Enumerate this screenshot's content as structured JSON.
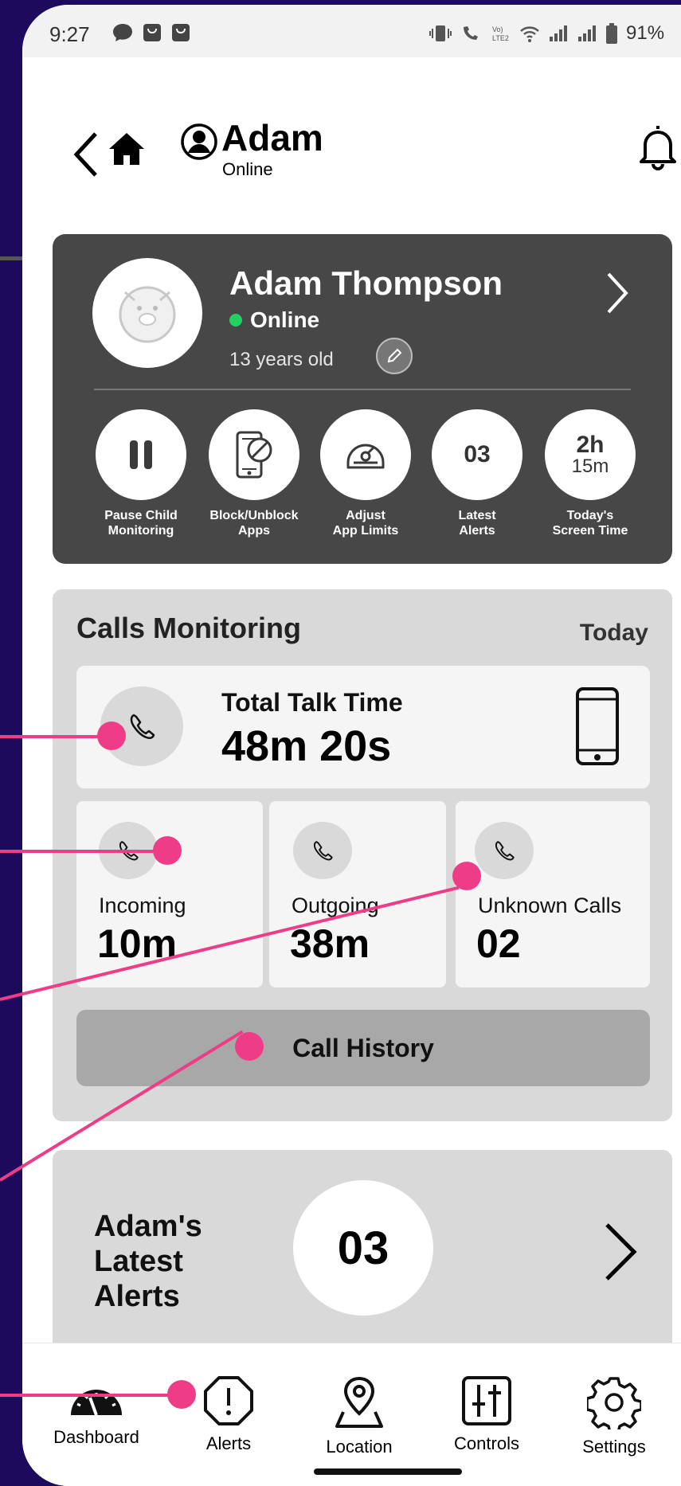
{
  "status_bar": {
    "time": "9:27",
    "battery": "91%"
  },
  "header": {
    "name": "Adam",
    "status": "Online"
  },
  "profile": {
    "full_name": "Adam Thompson",
    "status": "Online",
    "age": "13 years old"
  },
  "quick_actions": [
    {
      "label_line1": "Pause Child",
      "label_line2": "Monitoring"
    },
    {
      "label_line1": "Block/Unblock",
      "label_line2": "Apps"
    },
    {
      "label_line1": "Adjust",
      "label_line2": "App Limits"
    },
    {
      "label_line1": "Latest",
      "label_line2": "Alerts",
      "value": "03"
    },
    {
      "label_line1": "Today's",
      "label_line2": "Screen Time",
      "value_big": "2h",
      "value_small": "15m"
    }
  ],
  "calls": {
    "title": "Calls Monitoring",
    "period": "Today",
    "total_label": "Total Talk Time",
    "total_value": "48m 20s",
    "stats": [
      {
        "label": "Incoming",
        "value": "10m"
      },
      {
        "label": "Outgoing",
        "value": "38m"
      },
      {
        "label": "Unknown Calls",
        "value": "02"
      }
    ],
    "history_button": "Call History"
  },
  "alerts": {
    "title_lines": [
      "Adam's",
      "Latest",
      "Alerts"
    ],
    "count": "03"
  },
  "nav": [
    {
      "label": "Dashboard"
    },
    {
      "label": "Alerts"
    },
    {
      "label": "Location"
    },
    {
      "label": "Controls"
    },
    {
      "label": "Settings"
    }
  ],
  "colors": {
    "background": "#1e0a5c",
    "card_dark": "#474747",
    "card_light": "#d9d9d9",
    "annotation": "#ee3d86",
    "online": "#23d160"
  }
}
